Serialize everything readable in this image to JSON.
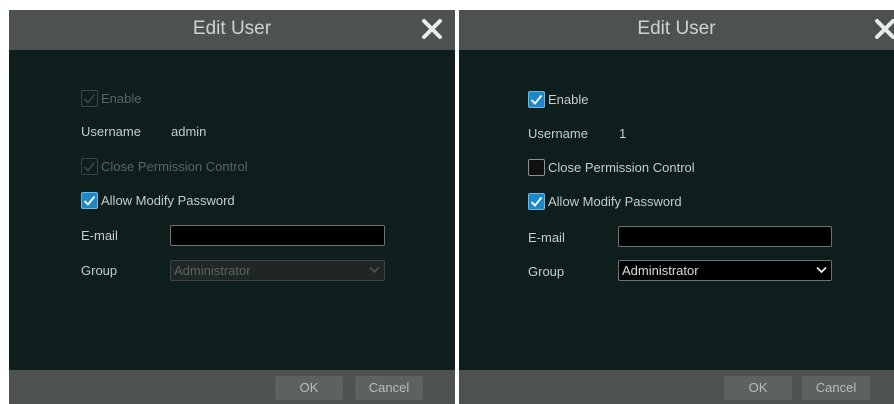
{
  "left_dialog": {
    "title": "Edit User",
    "enable_label": "Enable",
    "enable_checked": true,
    "enable_disabled": true,
    "username_label": "Username",
    "username_value": "admin",
    "close_permission_label": "Close Permission Control",
    "close_permission_checked": true,
    "close_permission_disabled": true,
    "allow_modify_label": "Allow Modify Password",
    "allow_modify_checked": true,
    "email_label": "E-mail",
    "email_value": "",
    "group_label": "Group",
    "group_value": "Administrator",
    "group_disabled": true,
    "ok_label": "OK",
    "cancel_label": "Cancel"
  },
  "right_dialog": {
    "title": "Edit User",
    "enable_label": "Enable",
    "enable_checked": true,
    "username_label": "Username",
    "username_value": "1",
    "close_permission_label": "Close Permission Control",
    "close_permission_checked": false,
    "allow_modify_label": "Allow Modify Password",
    "allow_modify_checked": true,
    "email_label": "E-mail",
    "email_value": "",
    "group_label": "Group",
    "group_value": "Administrator",
    "ok_label": "OK",
    "cancel_label": "Cancel"
  },
  "colors": {
    "dialog_bg": "#0d1e1d",
    "bar_bg": "#4d5150",
    "checkbox_checked": "#1d87c7"
  },
  "icons": {
    "close": "close-icon",
    "check": "check-icon",
    "dropdown": "chevron-down-icon"
  }
}
